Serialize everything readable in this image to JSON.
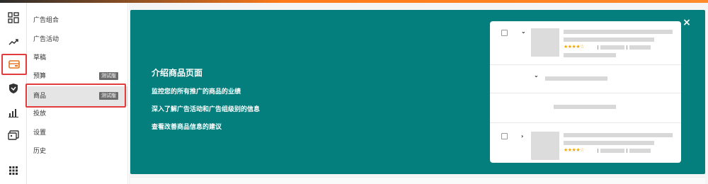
{
  "icons": {
    "rail": [
      "dashboard-icon",
      "trend-up-icon",
      "wallet-icon",
      "shield-icon",
      "bar-chart-icon",
      "media-icon",
      "apps-grid-icon"
    ],
    "close": "×",
    "accent": "#047f7d",
    "highlight": "#e23b3b"
  },
  "menu": {
    "items": [
      {
        "label": "广告组合",
        "badge": ""
      },
      {
        "label": "广告活动",
        "badge": ""
      },
      {
        "label": "草稿",
        "badge": ""
      },
      {
        "label": "预算",
        "badge": "测试版"
      },
      {
        "label": "商品",
        "badge": "测试版"
      },
      {
        "label": "投放",
        "badge": ""
      },
      {
        "label": "设置",
        "badge": ""
      },
      {
        "label": "历史",
        "badge": ""
      }
    ]
  },
  "banner": {
    "title": "介绍商品页面",
    "lines": [
      "监控您的所有推广的商品的业绩",
      "深入了解广告活动和广告组级别的信息",
      "查看改善商品信息的建议"
    ],
    "preview": {
      "stars": "★★★★☆"
    }
  }
}
